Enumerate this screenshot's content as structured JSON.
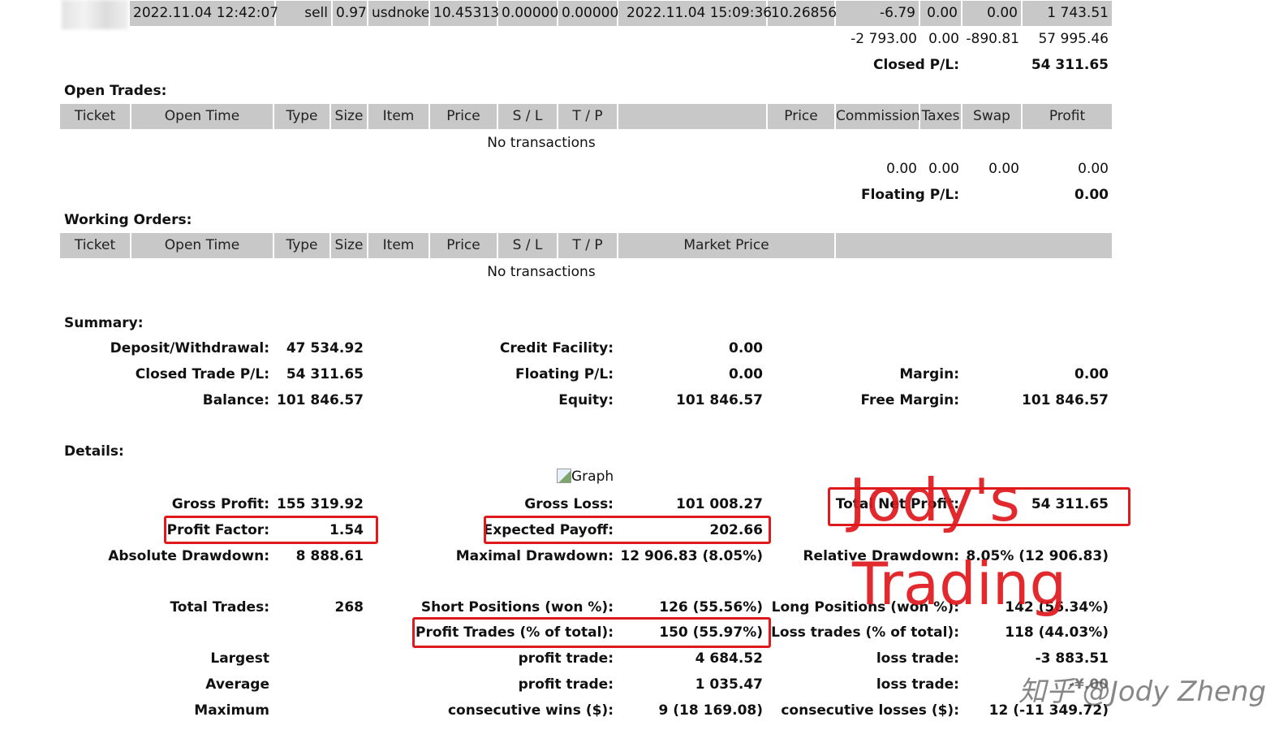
{
  "top_row": {
    "open_time": "2022.11.04 12:42:07",
    "type": "sell",
    "size": "0.97",
    "item": "usdnoke",
    "price": "10.45313",
    "sl": "0.00000",
    "tp": "0.00000",
    "close_time": "2022.11.04 15:09:36",
    "close_price": "10.26856",
    "commission": "-6.79",
    "taxes": "0.00",
    "swap": "0.00",
    "profit": "1 743.51"
  },
  "closed_totals": {
    "commission": "-2 793.00",
    "taxes": "0.00",
    "swap": "-890.81",
    "profit": "57 995.46",
    "pl_label": "Closed P/L:",
    "pl_value": "54 311.65"
  },
  "open_trades": {
    "title": "Open Trades:",
    "headers": [
      "Ticket",
      "Open Time",
      "Type",
      "Size",
      "Item",
      "Price",
      "S / L",
      "T / P",
      "",
      "Price",
      "Commission",
      "Taxes",
      "Swap",
      "Profit"
    ],
    "empty": "No transactions",
    "totals": {
      "commission": "0.00",
      "taxes": "0.00",
      "swap": "0.00",
      "profit": "0.00"
    },
    "pl_label": "Floating P/L:",
    "pl_value": "0.00"
  },
  "working_orders": {
    "title": "Working Orders:",
    "headers": [
      "Ticket",
      "Open Time",
      "Type",
      "Size",
      "Item",
      "Price",
      "S / L",
      "T / P",
      "Market Price",
      ""
    ],
    "empty": "No transactions"
  },
  "summary": {
    "title": "Summary:",
    "deposit_label": "Deposit/Withdrawal:",
    "deposit_value": "47 534.92",
    "credit_label": "Credit Facility:",
    "credit_value": "0.00",
    "closed_label": "Closed Trade P/L:",
    "closed_value": "54 311.65",
    "floating_label": "Floating P/L:",
    "floating_value": "0.00",
    "margin_label": "Margin:",
    "margin_value": "0.00",
    "balance_label": "Balance:",
    "balance_value": "101 846.57",
    "equity_label": "Equity:",
    "equity_value": "101 846.57",
    "free_margin_label": "Free Margin:",
    "free_margin_value": "101 846.57"
  },
  "details": {
    "title": "Details:",
    "graph_alt": "Graph",
    "gross_profit_label": "Gross Profit:",
    "gross_profit_value": "155 319.92",
    "gross_loss_label": "Gross Loss:",
    "gross_loss_value": "101 008.27",
    "net_profit_label": "Total Net Profit:",
    "net_profit_value": "54 311.65",
    "profit_factor_label": "Profit Factor:",
    "profit_factor_value": "1.54",
    "expected_payoff_label": "Expected Payoff:",
    "expected_payoff_value": "202.66",
    "abs_dd_label": "Absolute Drawdown:",
    "abs_dd_value": "8 888.61",
    "max_dd_label": "Maximal Drawdown:",
    "max_dd_value": "12 906.83 (8.05%)",
    "rel_dd_label": "Relative Drawdown:",
    "rel_dd_value": "8.05% (12 906.83)",
    "total_trades_label": "Total Trades:",
    "total_trades_value": "268",
    "short_label": "Short Positions (won %):",
    "short_value": "126 (55.56%)",
    "long_label": "Long Positions (won %):",
    "long_value": "142 (56.34%)",
    "profit_trades_label": "Profit Trades (% of total):",
    "profit_trades_value": "150 (55.97%)",
    "loss_trades_label": "Loss trades (% of total):",
    "loss_trades_value": "118 (44.03%)",
    "largest_label": "Largest",
    "largest_profit_label": "profit trade:",
    "largest_profit_value": "4 684.52",
    "largest_loss_label": "loss trade:",
    "largest_loss_value": "-3 883.51",
    "average_label": "Average",
    "avg_profit_label": "profit trade:",
    "avg_profit_value": "1 035.47",
    "avg_loss_label": "loss trade:",
    "avg_loss_value": "-¥.00",
    "maximum_label": "Maximum",
    "max_wins_label": "consecutive wins ($):",
    "max_wins_value": "9 (18 169.08)",
    "max_losses_label": "consecutive losses ($):",
    "max_losses_value": "12 (-11 349.72)"
  },
  "watermarks": {
    "line1": "Jody's",
    "line2": "Trading",
    "credit": "知乎 @Jody Zheng"
  },
  "colors": {
    "accent_red": "#e0191d",
    "header_gray": "#c8c8c8"
  }
}
